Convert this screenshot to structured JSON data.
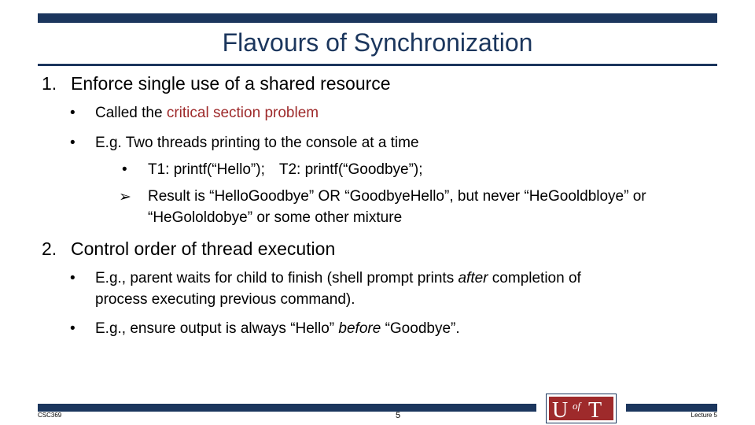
{
  "slide": {
    "title": "Flavours of Synchronization",
    "items": [
      {
        "number": "1.",
        "heading": "Enforce single use of a shared resource",
        "bullets": [
          {
            "pre": "Called the ",
            "highlight": "critical section problem"
          },
          {
            "text": "E.g. Two threads printing to the console at a time",
            "subbullets": [
              {
                "t1": "T1: printf(“Hello”);",
                "t2": "T2: printf(“Goodbye”);"
              }
            ],
            "arrow_item": {
              "line1": "Result is “HelloGoodbye” OR “GoodbyeHello”, but never “HeGooldbloye” or",
              "line2": "“HeGololdobye” or some other mixture"
            }
          }
        ]
      },
      {
        "number": "2.",
        "heading": "Control order of thread execution",
        "bullets": [
          {
            "pre": "E.g., parent waits for child to finish (shell prompt prints ",
            "em": "after",
            "post": " completion of",
            "line2": "process executing previous command)."
          },
          {
            "pre": "E.g., ensure output is always “Hello” ",
            "em": "before",
            "post": " “Goodbye”."
          }
        ]
      }
    ],
    "bullet_glyph": "•",
    "arrow_glyph": "➢"
  },
  "footer": {
    "course": "CSC369",
    "page_number": "5",
    "lecture": "Lecture 5",
    "logo": {
      "letters_big_left": "U",
      "letters_small": "of",
      "letters_big_right": "T",
      "icon": "university-of-toronto-logo"
    }
  },
  "colors": {
    "navy": "#1b365d",
    "accent_red": "#9e2a2b"
  }
}
